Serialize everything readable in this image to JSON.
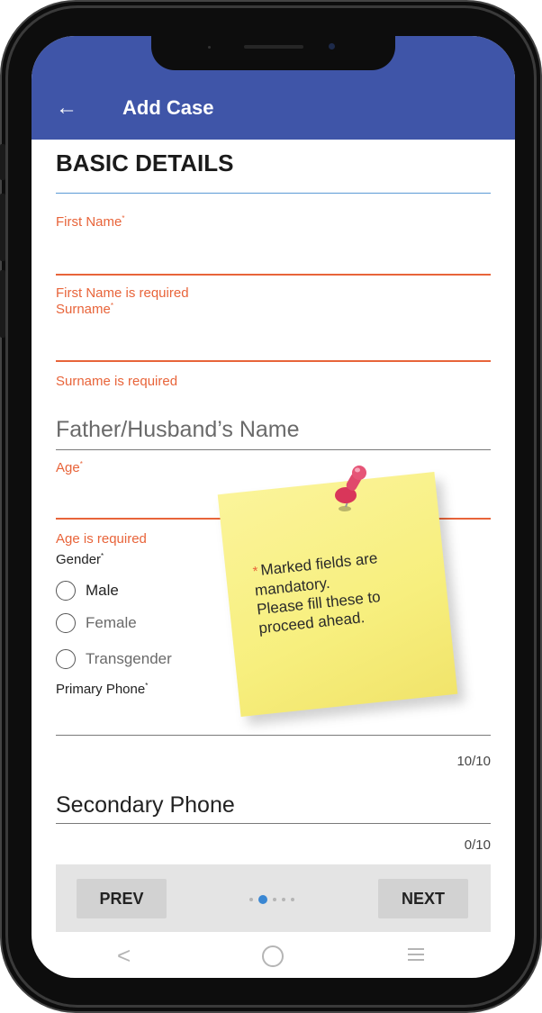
{
  "appbar": {
    "back_icon": "arrow-left-icon",
    "title": "Add Case"
  },
  "section": {
    "title": "BASIC DETAILS"
  },
  "fields": {
    "first_name": {
      "label": "First Name",
      "required_mark": "*",
      "error": "First Name is required"
    },
    "surname": {
      "label": "Surname",
      "required_mark": "*",
      "error": "Surname is required"
    },
    "father_husband": {
      "placeholder": "Father/Husband’s Name"
    },
    "age": {
      "label": "Age",
      "required_mark": "*",
      "error": "Age is required"
    },
    "gender": {
      "label": "Gender",
      "required_mark": "*",
      "options": [
        "Male",
        "Female",
        "Transgender"
      ]
    },
    "primary_phone": {
      "label": "Primary Phone",
      "required_mark": "*",
      "counter": "10/10"
    },
    "secondary_phone": {
      "value": "Secondary Phone",
      "counter": "0/10"
    }
  },
  "sticky_note": {
    "star": "*",
    "text": "Marked fields are\nmandatory.\nPlease fill these to\nproceed ahead."
  },
  "pager": {
    "prev_label": "PREV",
    "next_label": "NEXT",
    "total_pages": 5,
    "current_page": 2
  },
  "system_nav": {
    "back_icon": "back-chevron-icon",
    "home_icon": "home-circle-icon",
    "menu_icon": "menu-lines-icon"
  },
  "colors": {
    "appbar": "#3f55a8",
    "error": "#e8643a",
    "accent": "#3a87d3",
    "sticky": "#f7ef7e"
  }
}
